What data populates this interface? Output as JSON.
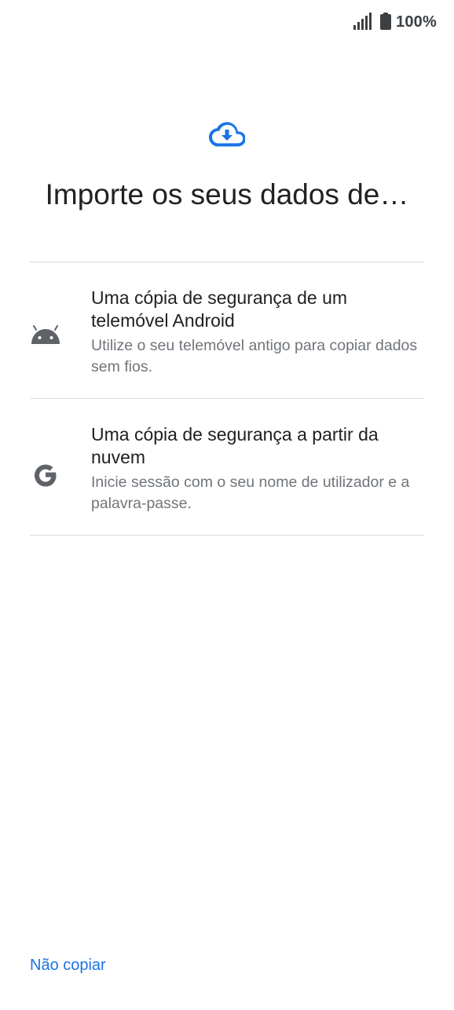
{
  "status_bar": {
    "signal_icon": "signal-icon",
    "battery_icon": "battery-icon",
    "battery_percent": "100%"
  },
  "header": {
    "icon": "cloud-download-icon",
    "title": "Importe os seus dados de…"
  },
  "options": [
    {
      "icon": "android-icon",
      "title": "Uma cópia de segurança de um telemóvel Android",
      "subtitle": "Utilize o seu telemóvel antigo para copiar dados sem fios."
    },
    {
      "icon": "google-g-icon",
      "title": "Uma cópia de segurança a partir da nuvem",
      "subtitle": "Inicie sessão com o seu nome de utilizador e a palavra-passe."
    }
  ],
  "footer": {
    "skip_label": "Não copiar"
  },
  "colors": {
    "accent": "#1a73e8",
    "text_primary": "#202124",
    "text_secondary": "#70757a",
    "divider": "#dadce0",
    "icon_gray": "#5f6368"
  }
}
